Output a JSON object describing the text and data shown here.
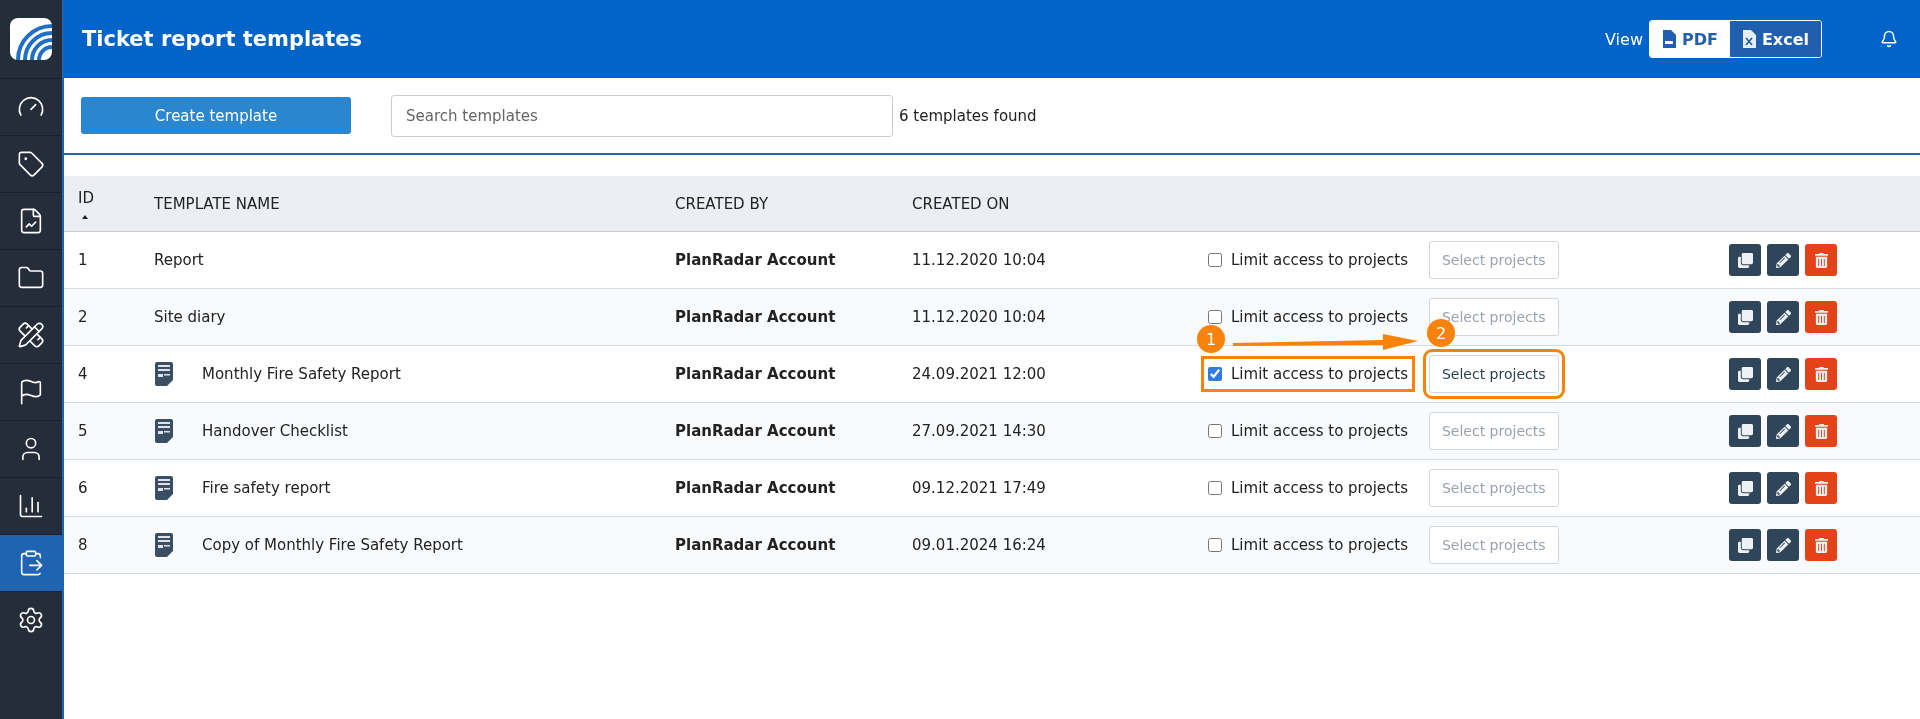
{
  "sidebar": {
    "items": [
      {
        "selected": false
      },
      {
        "selected": false
      },
      {
        "selected": false
      },
      {
        "selected": false
      },
      {
        "selected": false
      },
      {
        "selected": false
      },
      {
        "selected": false
      },
      {
        "selected": false
      },
      {
        "selected": true
      },
      {
        "selected": false
      }
    ]
  },
  "header": {
    "title": "Ticket report templates",
    "view_label": "View",
    "formats": [
      {
        "label": "PDF",
        "kind": "pdf",
        "selected": false
      },
      {
        "label": "Excel",
        "kind": "excel",
        "selected": true
      }
    ]
  },
  "toolbar": {
    "create_button": "Create template",
    "search": {
      "placeholder": "Search templates"
    },
    "count": "6 templates found"
  },
  "table": {
    "columns": [
      {
        "label": "ID",
        "sorted": true
      },
      {
        "label": "TEMPLATE NAME",
        "sorted": false
      },
      {
        "label": "CREATED BY",
        "sorted": false
      },
      {
        "label": "CREATED ON",
        "sorted": false
      }
    ],
    "rows": [
      {
        "id": "1",
        "name": "Report",
        "kind": "default",
        "created_by": "PlanRadar Account",
        "created_on": "11.12.2020 10:04",
        "limit_label": "Limit access to projects",
        "checked": false,
        "select_button": "Select projects",
        "highlighted": false
      },
      {
        "id": "2",
        "name": "Site diary",
        "kind": "default",
        "created_by": "PlanRadar Account",
        "created_on": "11.12.2020 10:04",
        "limit_label": "Limit access to projects",
        "checked": false,
        "select_button": "Select projects",
        "highlighted": false
      },
      {
        "id": "4",
        "name": "Monthly Fire Safety Report",
        "kind": "custom",
        "created_by": "PlanRadar Account",
        "created_on": "24.09.2021 12:00",
        "limit_label": "Limit access to projects",
        "checked": true,
        "select_button": "Select projects",
        "highlighted": true
      },
      {
        "id": "5",
        "name": "Handover Checklist",
        "kind": "custom",
        "created_by": "PlanRadar Account",
        "created_on": "27.09.2021 14:30",
        "limit_label": "Limit access to projects",
        "checked": false,
        "select_button": "Select projects",
        "highlighted": false
      },
      {
        "id": "6",
        "name": "Fire safety report",
        "kind": "custom",
        "created_by": "PlanRadar Account",
        "created_on": "09.12.2021 17:49",
        "limit_label": "Limit access to projects",
        "checked": false,
        "select_button": "Select projects",
        "highlighted": false
      },
      {
        "id": "8",
        "name": "Copy of Monthly Fire Safety Report",
        "kind": "custom",
        "created_by": "PlanRadar Account",
        "created_on": "09.01.2024 16:24",
        "limit_label": "Limit access to projects",
        "checked": false,
        "select_button": "Select projects",
        "highlighted": false
      }
    ]
  },
  "annotations": [
    {
      "label": "1"
    },
    {
      "label": "2"
    }
  ]
}
